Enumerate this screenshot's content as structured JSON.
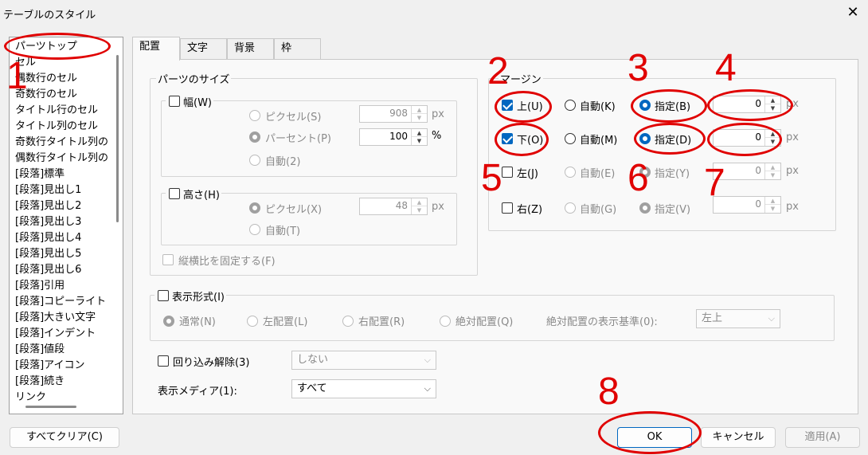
{
  "window": {
    "title": "テーブルのスタイル",
    "close_glyph": "✕"
  },
  "list": {
    "items": [
      "パーツトップ",
      "セル",
      "偶数行のセル",
      "奇数行のセル",
      "タイトル行のセル",
      "タイトル列のセル",
      "奇数行タイトル列の",
      "偶数行タイトル列の",
      "[段落]標準",
      "[段落]見出し1",
      "[段落]見出し2",
      "[段落]見出し3",
      "[段落]見出し4",
      "[段落]見出し5",
      "[段落]見出し6",
      "[段落]引用",
      "[段落]コピーライト",
      "[段落]大きい文字",
      "[段落]インデント",
      "[段落]値段",
      "[段落]アイコン",
      "[段落]続き",
      "リンク"
    ]
  },
  "tabs": [
    "配置",
    "文字",
    "背景",
    "枠"
  ],
  "size_group": {
    "label": "パーツのサイズ",
    "width": {
      "label": "幅(W)",
      "pixel": "ピクセル(S)",
      "percent": "パーセント(P)",
      "auto": "自動(2)",
      "pixel_value": "908",
      "pixel_unit": "px",
      "percent_value": "100",
      "percent_unit": "%"
    },
    "height": {
      "label": "高さ(H)",
      "pixel": "ピクセル(X)",
      "auto": "自動(T)",
      "pixel_value": "48",
      "pixel_unit": "px"
    },
    "aspect": "縦横比を固定する(F)"
  },
  "margin_group": {
    "label": "マージン",
    "top": {
      "label": "上(U)",
      "auto": "自動(K)",
      "specify": "指定(B)",
      "value": "0",
      "unit": "px"
    },
    "bottom": {
      "label": "下(O)",
      "auto": "自動(M)",
      "specify": "指定(D)",
      "value": "0",
      "unit": "px"
    },
    "left": {
      "label": "左(J)",
      "auto": "自動(E)",
      "specify": "指定(Y)",
      "value": "0",
      "unit": "px"
    },
    "right": {
      "label": "右(Z)",
      "auto": "自動(G)",
      "specify": "指定(V)",
      "value": "0",
      "unit": "px"
    }
  },
  "display_group": {
    "label": "表示形式(I)",
    "normal": "通常(N)",
    "left": "左配置(L)",
    "right": "右配置(R)",
    "absolute": "絶対配置(Q)",
    "base_label": "絶対配置の表示基準(0):",
    "base_value": "左上"
  },
  "wrap": {
    "label": "回り込み解除(3)",
    "value": "しない"
  },
  "media": {
    "label": "表示メディア(1):",
    "value": "すべて"
  },
  "buttons": {
    "clear_all": "すべてクリア(C)",
    "ok": "OK",
    "cancel": "キャンセル",
    "apply": "適用(A)"
  },
  "annotations": [
    "1",
    "2",
    "3",
    "4",
    "5",
    "6",
    "7",
    "8"
  ],
  "colors": {
    "annotation": "#e00000",
    "accent": "#0067c0"
  }
}
